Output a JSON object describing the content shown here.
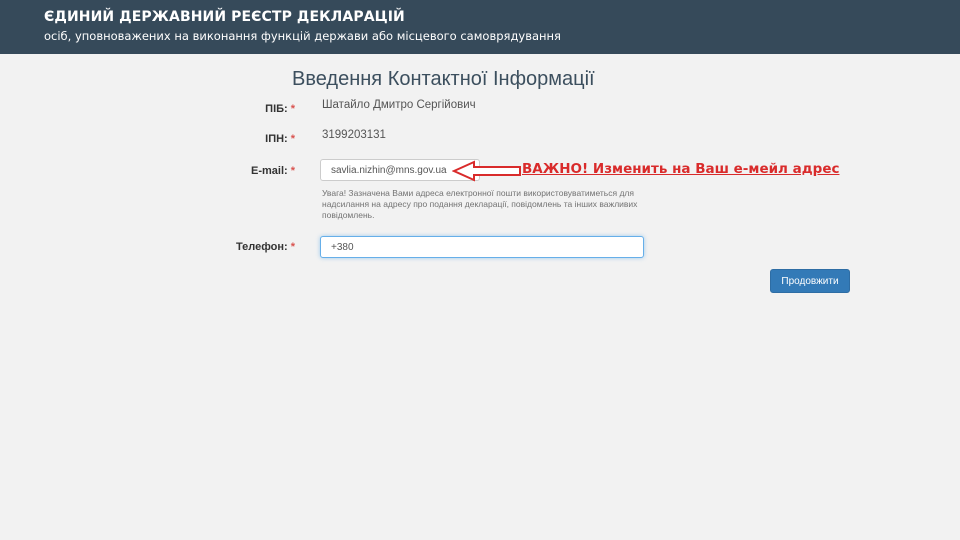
{
  "header": {
    "title": "ЄДИНИЙ ДЕРЖАВНИЙ РЕЄСТР ДЕКЛАРАЦІЙ",
    "subtitle": "осіб, уповноважених на виконання функцій держави або місцевого самоврядування"
  },
  "form": {
    "title": "Введення Контактної Інформації",
    "required_mark": "*",
    "fields": {
      "pib": {
        "label": "ПІБ:",
        "value": "Шатайло Дмитро Сергійович"
      },
      "ipn": {
        "label": "ІПН:",
        "value": "3199203131"
      },
      "email": {
        "label": "E-mail:",
        "value": "savlia.nizhin@mns.gov.ua",
        "help": "Увага! Зазначена Вами адреса електронної пошти використовуватиметься для надсилання на адресу про подання декларації, повідомлень та інших важливих повідомлень."
      },
      "phone": {
        "label": "Телефон:",
        "value": "+380"
      }
    },
    "continue_label": "Продовжити"
  },
  "annotation": {
    "text": "ВАЖНО! Изменить на Ваш е-мейл адрес",
    "color": "#d92b2b"
  },
  "colors": {
    "header_bg": "#364a5a",
    "page_bg": "#f2f2f2",
    "primary_button": "#337ab7",
    "required": "#d9534f"
  }
}
